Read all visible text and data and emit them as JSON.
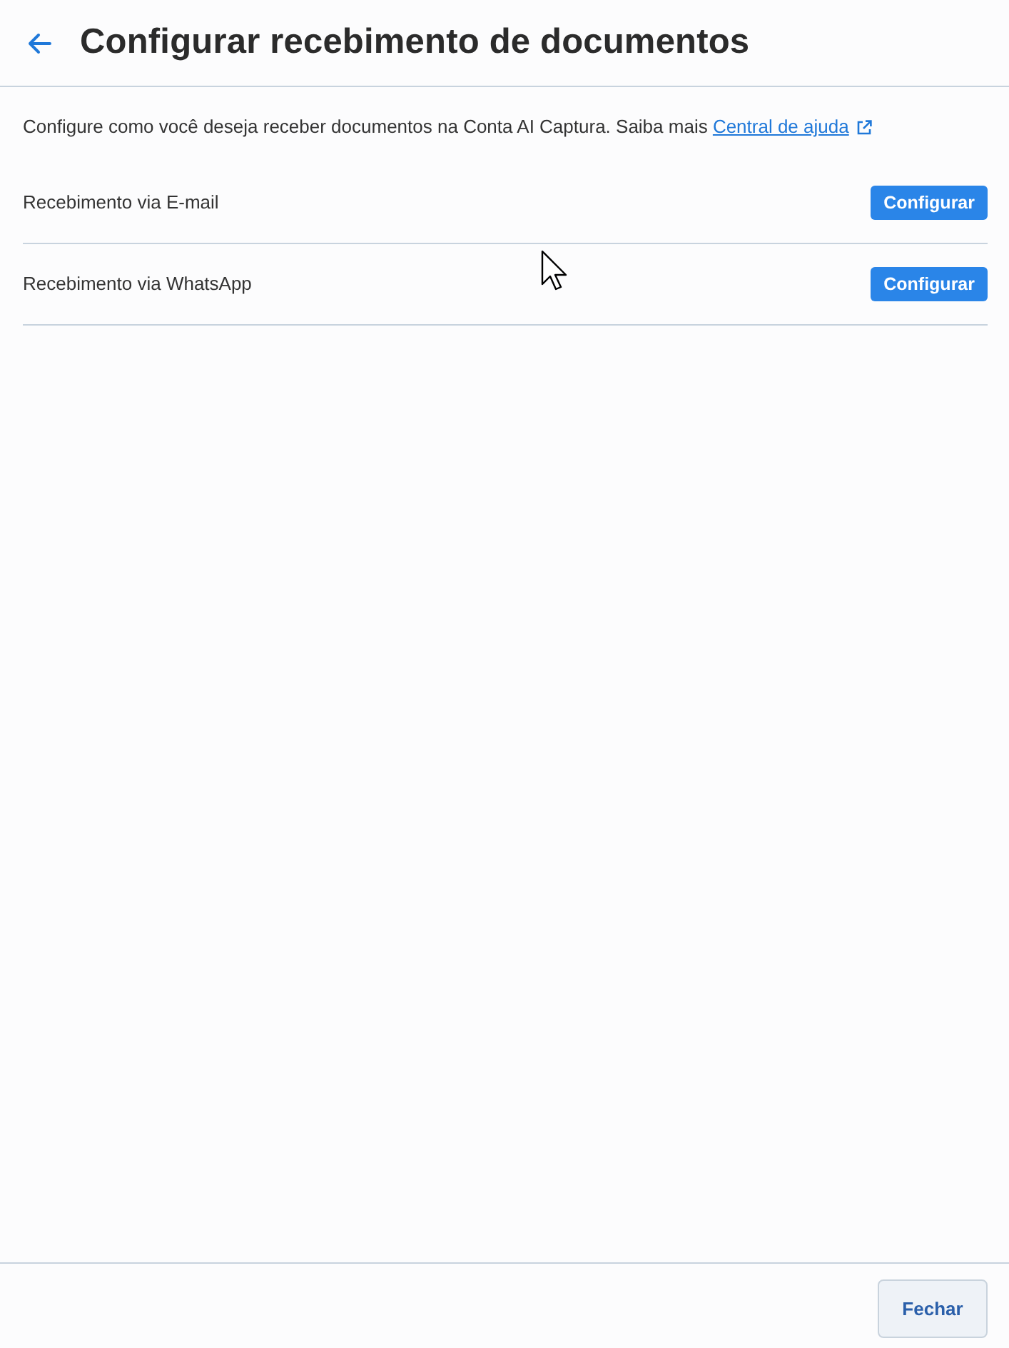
{
  "header": {
    "title": "Configurar recebimento de documentos"
  },
  "intro": {
    "text": "Configure como você deseja receber documentos na Conta AI Captura. Saiba mais",
    "link": "Central de ajuda"
  },
  "options": [
    {
      "label": "Recebimento via E-mail",
      "button": "Configurar"
    },
    {
      "label": "Recebimento via WhatsApp",
      "button": "Configurar"
    }
  ],
  "footer": {
    "buttons": [
      "Fechar"
    ]
  }
}
